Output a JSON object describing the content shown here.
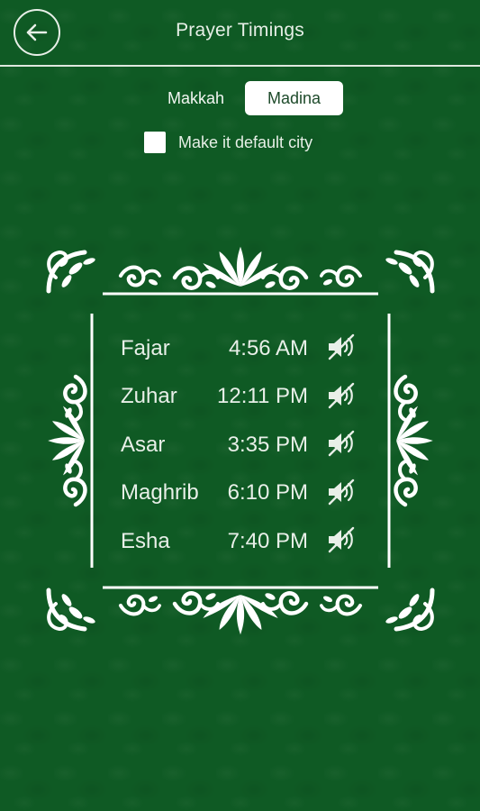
{
  "header": {
    "title": "Prayer Timings",
    "back_icon": "back-arrow-icon"
  },
  "city_tabs": [
    {
      "label": "Makkah",
      "selected": false
    },
    {
      "label": "Madina",
      "selected": true
    }
  ],
  "default_city": {
    "label": "Make it default city",
    "checked": false
  },
  "prayers": [
    {
      "name": "Fajar",
      "time": "4:56 AM",
      "sound_icon": "sound-muted-icon"
    },
    {
      "name": "Zuhar",
      "time": "12:11 PM",
      "sound_icon": "sound-muted-icon"
    },
    {
      "name": "Asar",
      "time": "3:35 PM",
      "sound_icon": "sound-muted-icon"
    },
    {
      "name": "Maghrib",
      "time": "6:10 PM",
      "sound_icon": "sound-muted-icon"
    },
    {
      "name": "Esha",
      "time": "7:40 PM",
      "sound_icon": "sound-muted-icon"
    }
  ],
  "colors": {
    "background": "#0f5a24",
    "text": "#e8efe8",
    "active_tab_text": "#1d4a2a"
  }
}
